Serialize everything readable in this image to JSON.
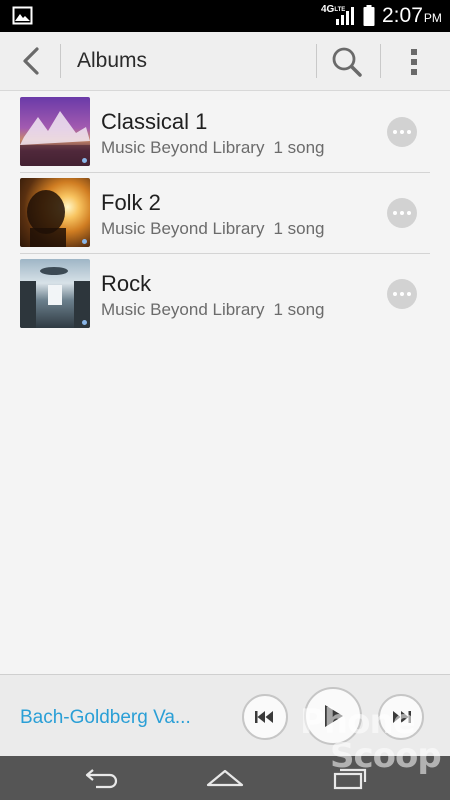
{
  "status_bar": {
    "network": "4G",
    "network_sub": "LTE",
    "time": "2:07",
    "ampm": "PM",
    "icons": [
      "gallery-icon",
      "signal-icon",
      "battery-icon"
    ]
  },
  "action_bar": {
    "title": "Albums",
    "icons": [
      "back-arrow-icon",
      "search-icon",
      "more-vert-icon"
    ]
  },
  "albums": [
    {
      "name": "Classical 1",
      "artist": "Music Beyond Library",
      "count": "1 song"
    },
    {
      "name": "Folk 2",
      "artist": "Music Beyond Library",
      "count": "1 song"
    },
    {
      "name": "Rock",
      "artist": "Music Beyond Library",
      "count": "1 song"
    }
  ],
  "now_playing": {
    "track": "Bach-Goldberg Va...",
    "icons": [
      "previous-icon",
      "play-icon",
      "next-icon"
    ]
  },
  "nav_bar": {
    "icons": [
      "nav-back-icon",
      "nav-home-icon",
      "nav-recents-icon"
    ]
  },
  "watermark": {
    "line1": "Phone",
    "line2": "Scoop"
  },
  "colors": {
    "accent": "#2a9fd6",
    "status_bar": "#000000",
    "nav_bar": "#555555",
    "background": "#f4f4f4"
  }
}
